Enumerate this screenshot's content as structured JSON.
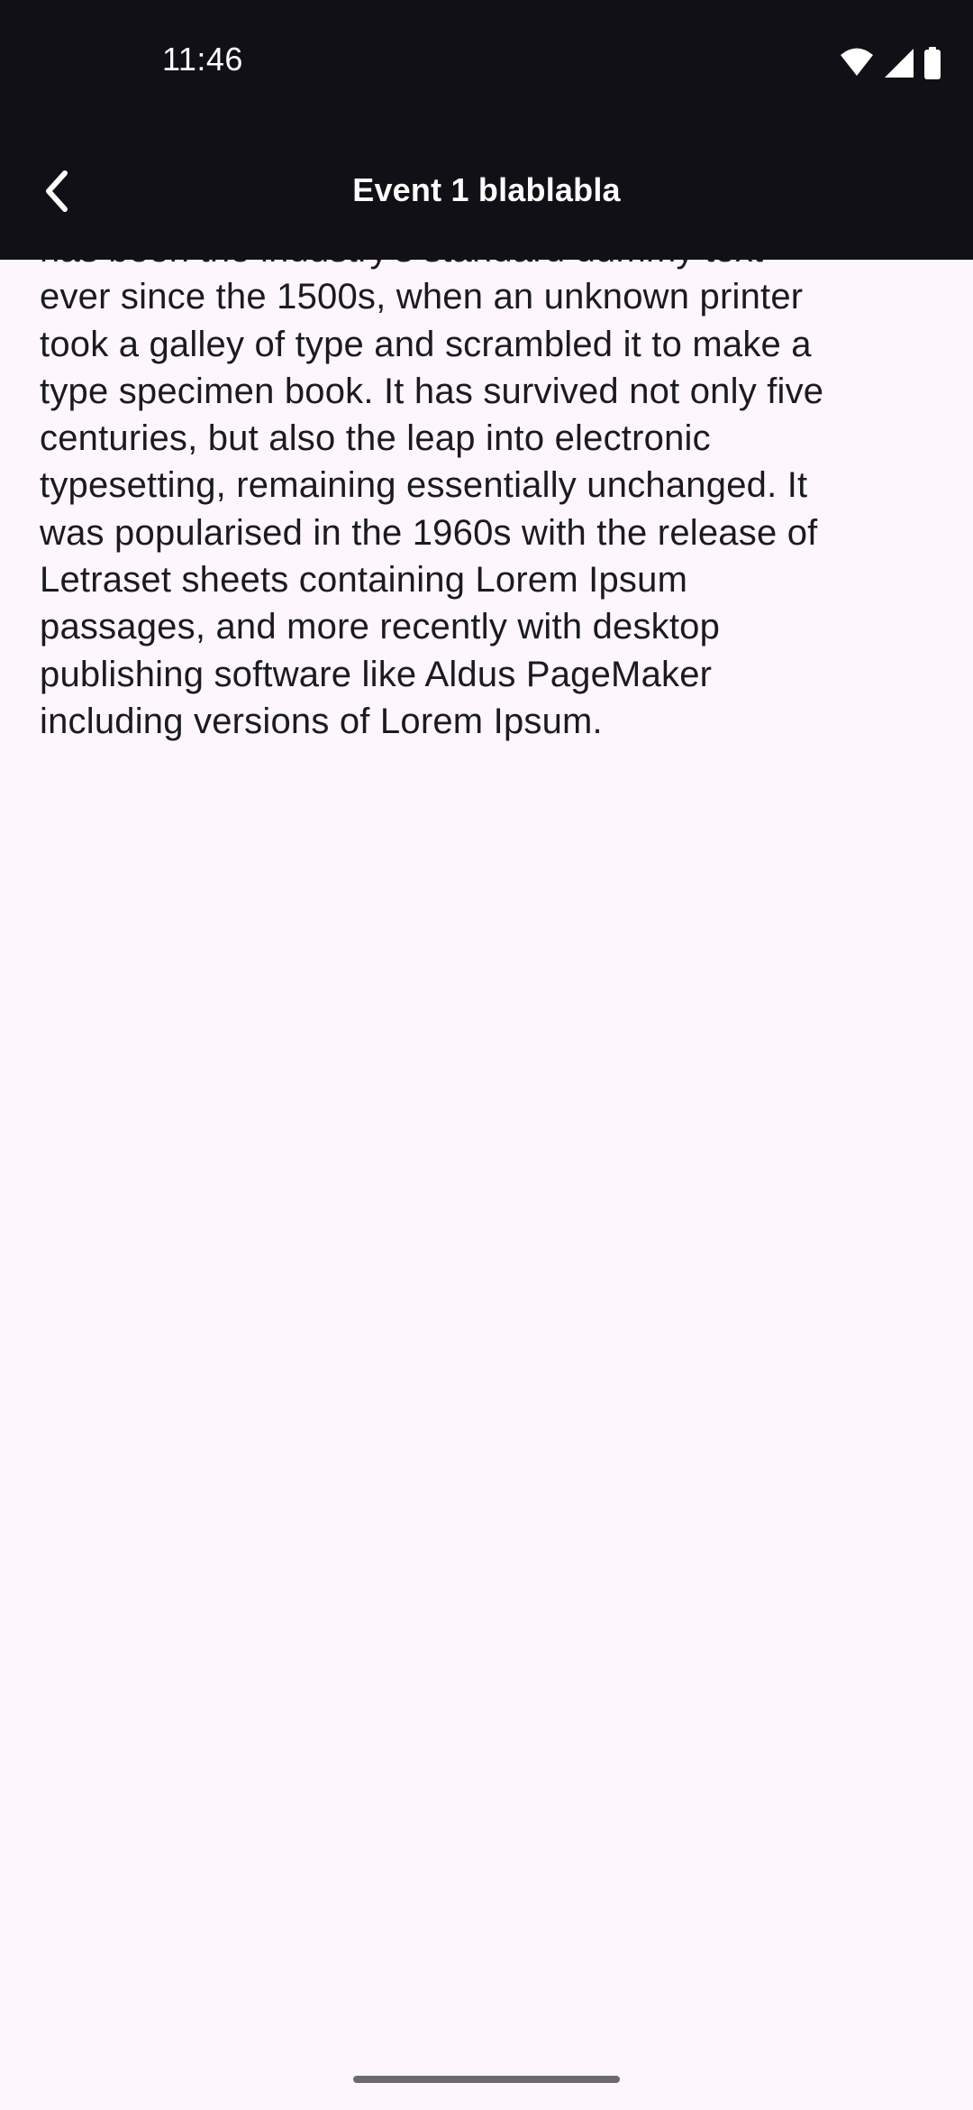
{
  "status_bar": {
    "time": "11:46",
    "icons": [
      "wifi-icon",
      "signal-icon",
      "battery-icon"
    ]
  },
  "app_bar": {
    "title": "Event 1 blablabla",
    "back_icon": "chevron-left-icon"
  },
  "body": {
    "text": "has been the industry's standard dummy text\never since the 1500s, when an unknown printer\ntook a galley of type and scrambled it to make a\ntype specimen book. It has survived not only five\ncenturies, but also the leap into electronic\ntypesetting, remaining essentially unchanged. It\nwas popularised in the 1960s with the release of\nLetraset sheets containing Lorem Ipsum\npassages, and more recently with desktop\npublishing software like Aldus PageMaker\nincluding versions of Lorem Ipsum."
  },
  "colors": {
    "app_bar_background": "#111016",
    "page_background": "#fdf7fd",
    "text": "#1b1b1f",
    "on_app_bar": "#ffffff"
  }
}
